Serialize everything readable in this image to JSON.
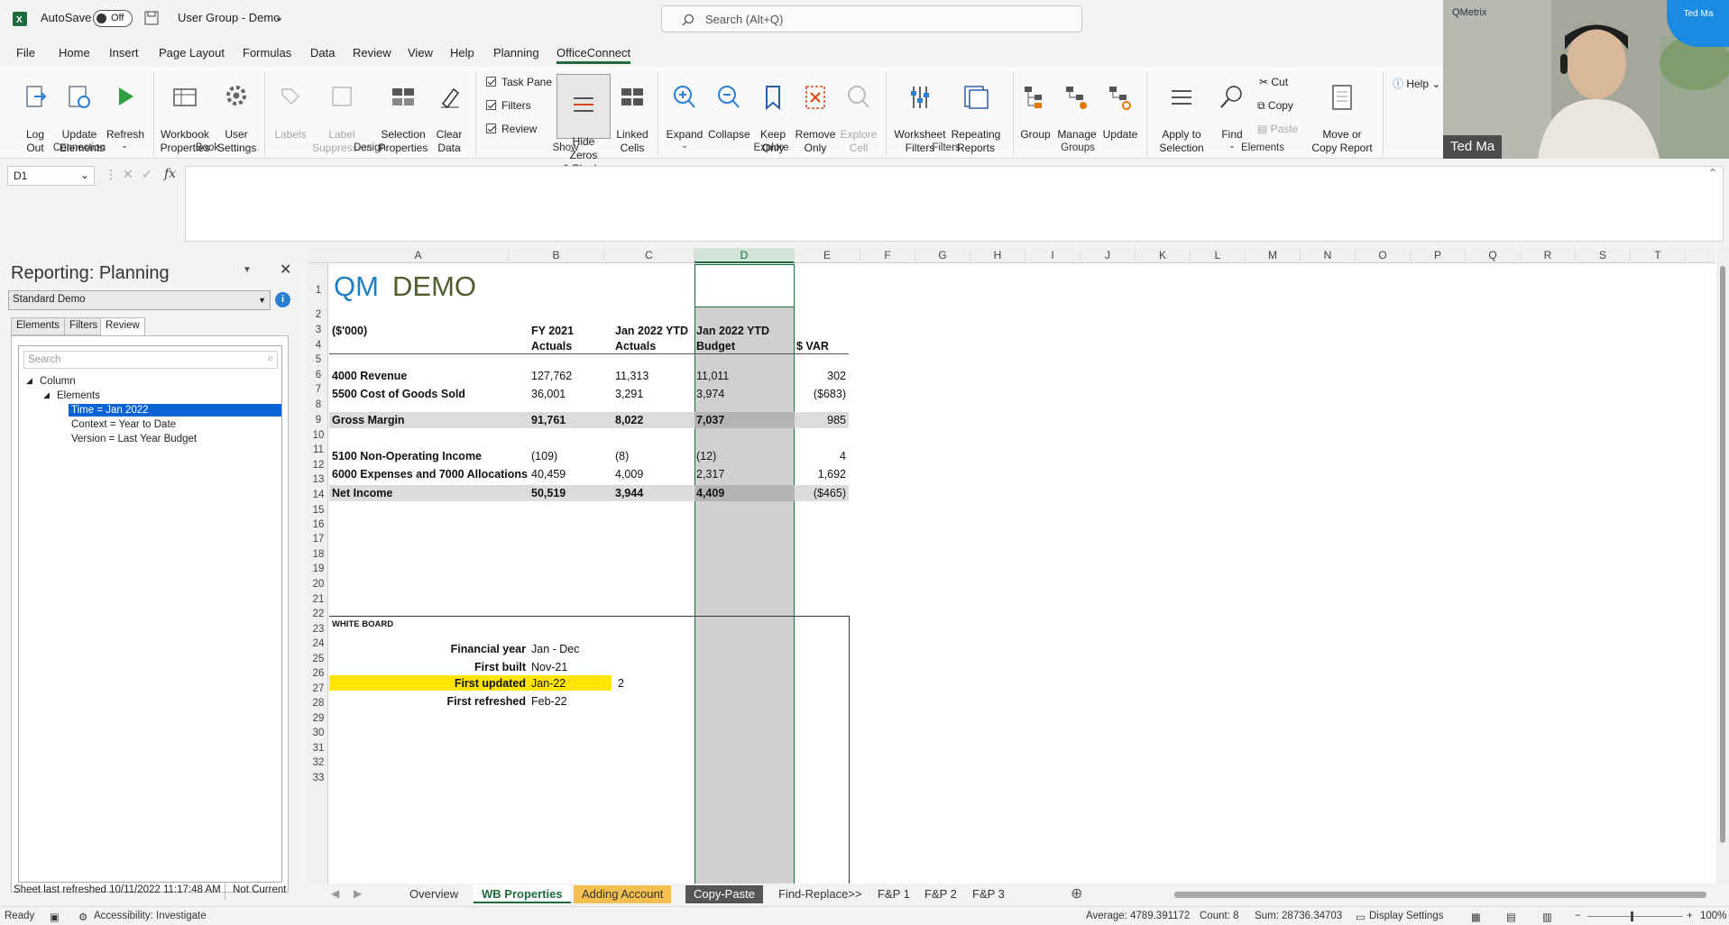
{
  "titlebar": {
    "autosave": "AutoSave",
    "toggle": "Off",
    "doc_title": "User Group - Demo",
    "search_placeholder": "Search (Alt+Q)"
  },
  "menu": [
    "File",
    "Home",
    "Insert",
    "Page Layout",
    "Formulas",
    "Data",
    "Review",
    "View",
    "Help",
    "Planning",
    "OfficeConnect"
  ],
  "ribbon": {
    "buttons": {
      "logout": "Log\nOut",
      "update_elements": "Update\nElements",
      "refresh": "Refresh",
      "workbook_props": "Workbook\nProperties",
      "user_settings": "User\nSettings",
      "labels": "Labels",
      "label_suppression": "Label\nSuppression",
      "selection_props": "Selection\nProperties",
      "clear_data": "Clear\nData",
      "task_pane": "Task Pane",
      "filters_chk": "Filters",
      "review_chk": "Review",
      "hide_zeros": "Hide Zeros\n& Blanks",
      "linked_cells": "Linked\nCells",
      "expand": "Expand",
      "collapse": "Collapse",
      "keep_only": "Keep\nOnly",
      "remove_only": "Remove\nOnly",
      "explore_cell": "Explore\nCell",
      "worksheet_filters": "Worksheet\nFilters",
      "repeating_reports": "Repeating\nReports",
      "group": "Group",
      "manage": "Manage",
      "update": "Update",
      "apply_to_selection": "Apply to\nSelection",
      "find": "Find",
      "cut": "Cut",
      "copy": "Copy",
      "paste": "Paste",
      "move_copy_report": "Move or\nCopy Report",
      "help": "Help"
    },
    "groups": {
      "connection": "Connection",
      "book": "Book",
      "design": "Design",
      "show": "Show",
      "explore": "Explore",
      "filters": "Filters",
      "groups": "Groups",
      "elements": "Elements"
    }
  },
  "formula_bar": {
    "name_box": "D1",
    "fx": "fx"
  },
  "task_pane": {
    "title": "Reporting: Planning",
    "selected": "Standard Demo",
    "tabs": [
      "Elements",
      "Filters",
      "Review"
    ],
    "search_placeholder": "Search",
    "tree": {
      "root": "Column",
      "child": "Elements",
      "items": [
        "Time = Jan 2022",
        "Context = Year to Date",
        "Version = Last Year Budget"
      ]
    },
    "status_left": "Sheet last refreshed 10/11/2022 11:17:48 AM",
    "status_right": "Not Current"
  },
  "sheet": {
    "columns": [
      "A",
      "B",
      "C",
      "D",
      "E",
      "F",
      "G",
      "H",
      "I",
      "J",
      "K",
      "L",
      "M",
      "N",
      "O",
      "P",
      "Q",
      "R",
      "S",
      "T"
    ],
    "rows": [
      "1",
      "2",
      "3",
      "4",
      "5",
      "6",
      "7",
      "8",
      "9",
      "10",
      "11",
      "12",
      "13",
      "14",
      "15",
      "16",
      "17",
      "18",
      "19",
      "20",
      "21",
      "22",
      "23",
      "24",
      "25",
      "26",
      "27",
      "28",
      "29",
      "30",
      "31",
      "32",
      "33"
    ],
    "title_qm": "QM",
    "title_demo": "DEMO",
    "units": "($'000)",
    "headers": {
      "b3": "FY 2021",
      "b4": "Actuals",
      "c3": "Jan 2022 YTD",
      "c4": "Actuals",
      "d3": "Jan 2022 YTD",
      "d4": "Budget",
      "e4": "$ VAR"
    },
    "lines": [
      {
        "label": "4000 Revenue",
        "b": "127,762",
        "c": "11,313",
        "d": "11,011",
        "e": "302"
      },
      {
        "label": "5500 Cost of Goods Sold",
        "b": "36,001",
        "c": "3,291",
        "d": "3,974",
        "e": "($683)"
      },
      {
        "label": "Gross Margin",
        "b": "91,761",
        "c": "8,022",
        "d": "7,037",
        "e": "985"
      },
      {
        "label": "5100 Non-Operating Income",
        "b": "(109)",
        "c": "(8)",
        "d": "(12)",
        "e": "4"
      },
      {
        "label": "6000 Expenses and 7000 Allocations",
        "b": "40,459",
        "c": "4,009",
        "d": "2,317",
        "e": "1,692"
      },
      {
        "label": "Net Income",
        "b": "50,519",
        "c": "3,944",
        "d": "4,409",
        "e": "($465)"
      }
    ],
    "whiteboard": "WHITE BOARD",
    "info": [
      {
        "label": "Financial year",
        "value": "Jan - Dec"
      },
      {
        "label": "First built",
        "value": "Nov-21"
      },
      {
        "label": "First updated",
        "value": "Jan-22",
        "extra": "2"
      },
      {
        "label": "First refreshed",
        "value": "Feb-22"
      }
    ]
  },
  "sheet_tabs": [
    "Overview",
    "WB Properties",
    "Adding Account",
    "Copy-Paste",
    "Find-Replace>>",
    "F&P 1",
    "F&P 2",
    "F&P 3"
  ],
  "statusbar": {
    "ready": "Ready",
    "accessibility": "Accessibility: Investigate",
    "average": "Average: 4789.391172",
    "count": "Count: 8",
    "sum": "Sum: 28736.34703",
    "display_settings": "Display Settings",
    "zoom": "100%"
  },
  "video": {
    "brand": "QMetrix",
    "name": "Ted Ma",
    "avatar": "Ted Ma"
  },
  "colors": {
    "excel_green": "#1e6c3b",
    "selection_blue": "#0a64d6",
    "highlight_yellow": "#ffe600",
    "title_blue": "#1f7fc2",
    "title_olive": "#4f5d2f"
  }
}
